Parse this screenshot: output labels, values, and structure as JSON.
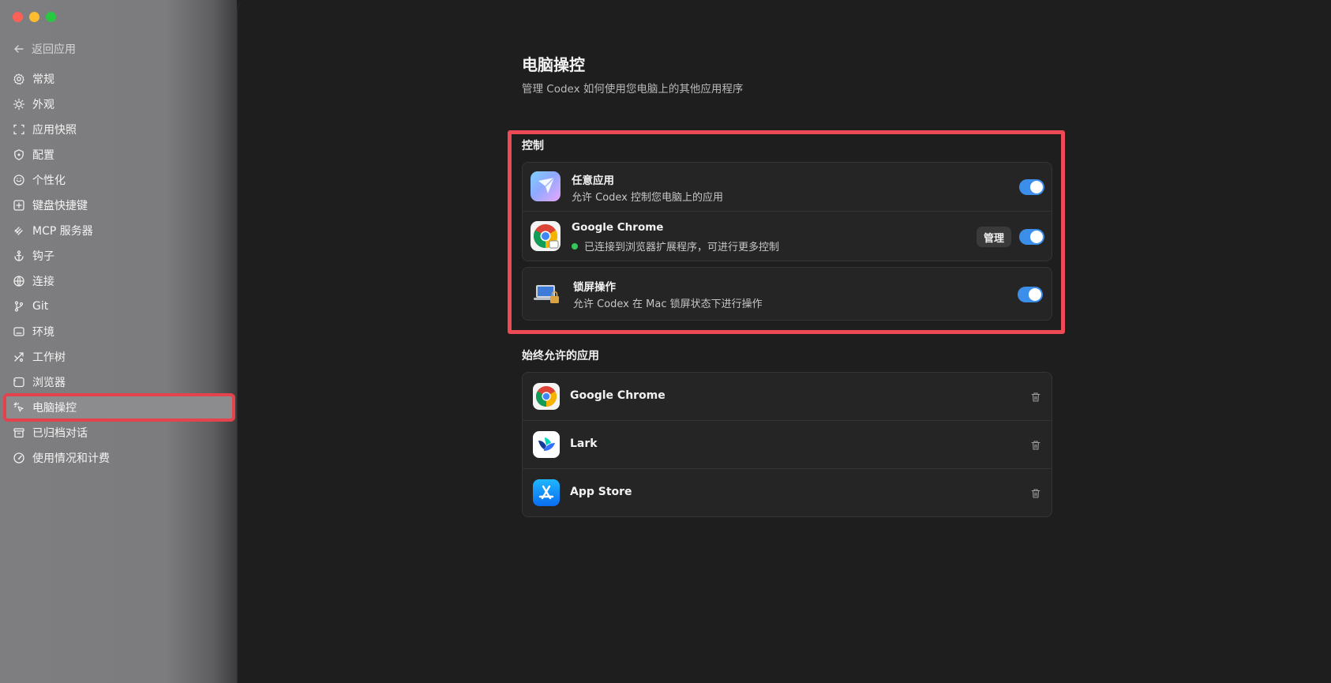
{
  "sidebar": {
    "back_label": "返回应用",
    "items": [
      {
        "label": "常规",
        "icon": "gear-icon"
      },
      {
        "label": "外观",
        "icon": "sun-icon"
      },
      {
        "label": "应用快照",
        "icon": "scan-icon"
      },
      {
        "label": "配置",
        "icon": "config-icon"
      },
      {
        "label": "个性化",
        "icon": "personalize-icon"
      },
      {
        "label": "键盘快捷键",
        "icon": "keyboard-icon"
      },
      {
        "label": "MCP 服务器",
        "icon": "mcp-icon"
      },
      {
        "label": "钩子",
        "icon": "anchor-icon"
      },
      {
        "label": "连接",
        "icon": "globe-icon"
      },
      {
        "label": "Git",
        "icon": "git-branch-icon"
      },
      {
        "label": "环境",
        "icon": "environment-icon"
      },
      {
        "label": "工作树",
        "icon": "worktree-icon"
      },
      {
        "label": "浏览器",
        "icon": "browser-icon"
      },
      {
        "label": "电脑操控",
        "icon": "pointer-click-icon"
      },
      {
        "label": "已归档对话",
        "icon": "archive-icon"
      },
      {
        "label": "使用情况和计费",
        "icon": "gauge-icon"
      }
    ]
  },
  "page": {
    "title": "电脑操控",
    "subtitle": "管理 Codex 如何使用您电脑上的其他应用程序"
  },
  "control": {
    "label": "控制",
    "any_app": {
      "title": "任意应用",
      "desc": "允许 Codex 控制您电脑上的应用"
    },
    "chrome": {
      "title": "Google Chrome",
      "desc": "已连接到浏览器扩展程序，可进行更多控制",
      "manage_label": "管理"
    },
    "lock_screen": {
      "title": "锁屏操作",
      "desc": "允许 Codex 在 Mac 锁屏状态下进行操作"
    }
  },
  "allowed": {
    "label": "始终允许的应用",
    "apps": [
      {
        "name": "Google Chrome"
      },
      {
        "name": "Lark"
      },
      {
        "name": "App Store"
      }
    ]
  },
  "colors": {
    "accent": "#3b8eea",
    "highlight": "#ee4a55",
    "connected": "#34c759"
  }
}
